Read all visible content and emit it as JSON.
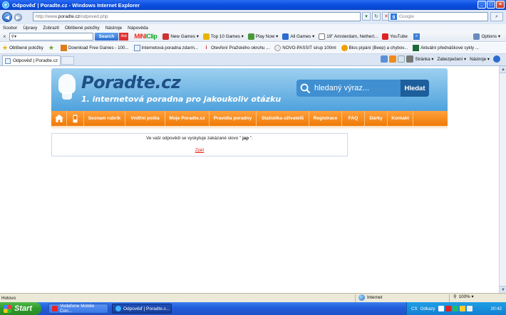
{
  "window": {
    "title": "Odpověď | Poradte.cz - Windows Internet Explorer",
    "controls": [
      "_",
      "□",
      "×"
    ]
  },
  "address_bar": {
    "url_prefix": "http://www.",
    "url_domain": "poradte.cz",
    "url_path": "/odpoved.php",
    "search_placeholder": "Google"
  },
  "menu": [
    "Soubor",
    "Úpravy",
    "Zobrazit",
    "Oblíbené položky",
    "Nástroje",
    "Nápověda"
  ],
  "toolbar": {
    "search_button": "Search",
    "ask_label": "Ask",
    "logo_a": "MIN",
    "logo_b": "IClip",
    "items": [
      "New Games ▾",
      "Top 10 Games ▾",
      "Play Now ▾",
      "All Games ▾",
      "19\" Amsterdam, Netherl...",
      "YouTube"
    ],
    "options_label": "Options ▾"
  },
  "favorites": {
    "label": "Oblíbené položky",
    "items": [
      "Download Free Games - 100...",
      "Internetová poradna zdarm...",
      "Otevření Pražského okruhu ...",
      "NOVO-PASSIT sirup 100ml",
      "Blos pípání (Beep) a chybov...",
      "Aktuální přednáškové cykly ..."
    ]
  },
  "tabs": {
    "active": "Odpověď | Poradte.cz"
  },
  "command_bar": [
    "Stránka ▾",
    "Zabezpečení ▾",
    "Nástroje ▾"
  ],
  "site": {
    "logo": "Poradte.cz",
    "tagline": "1. internetová poradna pro jakoukoliv otázku",
    "search_placeholder": "hledaný výraz...",
    "search_button": "Hledat",
    "nav": [
      "Seznam rubrik",
      "Vnitřní pošta",
      "Moje Poradte.cz",
      "Pravidla poradny",
      "Statistika uživatelů",
      "Registrace",
      "FAQ",
      "Dárky",
      "Kontakt"
    ],
    "message_prefix": "Ve vaší odpovědi se vyskytuje zakázané slovo \" ",
    "message_word": "jap",
    "message_suffix": " \".",
    "back_link": "Zpět"
  },
  "status": {
    "text": "Hotovo",
    "zone": "Internet",
    "zoom": "100% ▾"
  },
  "taskbar": {
    "start": "Start",
    "tasks": [
      "Vodafone Mobile Con...",
      "Odpověď | Poradte.c..."
    ],
    "lang": "CS",
    "links": "Odkazy",
    "clock": "20:42"
  },
  "colors": {
    "title_blue": "#0b4ee0",
    "header_blue": "#4ea2dd",
    "nav_orange": "#ef7a06",
    "logo_navy": "#1e4f86",
    "link_red": "#d21111"
  }
}
